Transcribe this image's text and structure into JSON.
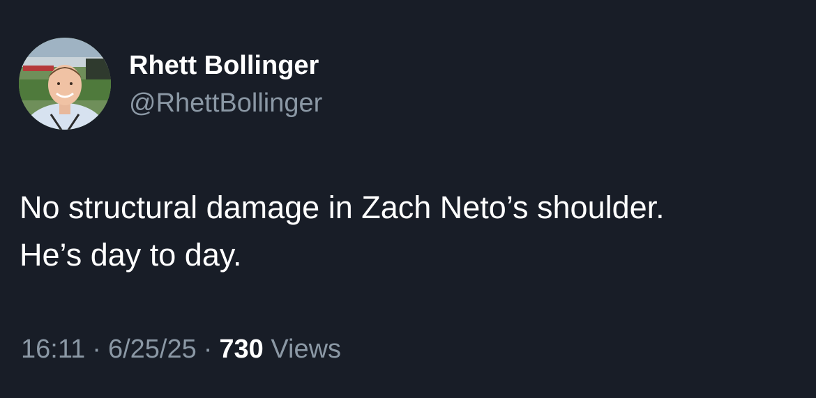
{
  "author": {
    "display_name": "Rhett Bollinger",
    "handle": "@RhettBollinger"
  },
  "tweet": {
    "lines": [
      "No structural damage in Zach Neto’s shoulder.",
      "He’s day to day."
    ]
  },
  "meta": {
    "time": "16:11",
    "separator": "·",
    "date": "6/25/25",
    "views_count": "730",
    "views_label": "Views"
  },
  "colors": {
    "background": "#181d27",
    "primary_text": "#ffffff",
    "secondary_text": "#8b98a5"
  }
}
